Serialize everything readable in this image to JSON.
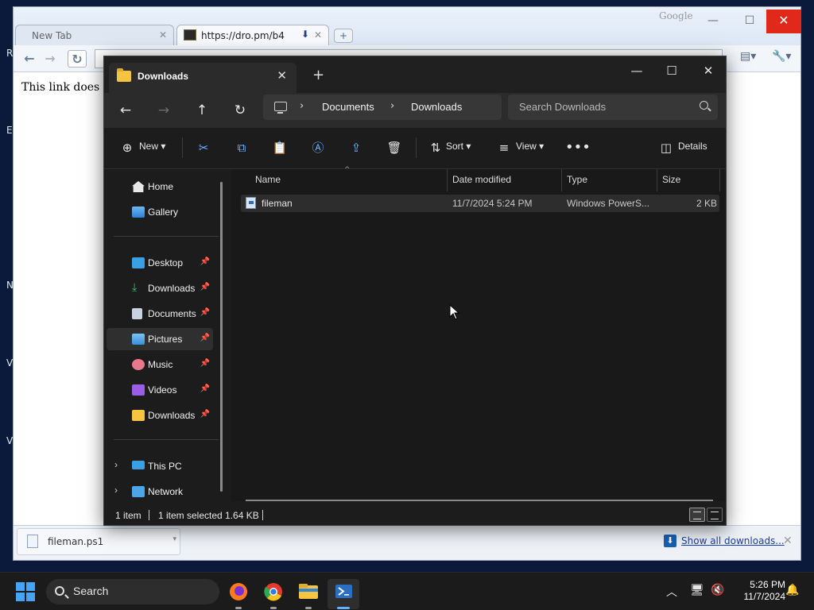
{
  "desktop": {
    "edge_letters": [
      "R",
      "E",
      "N",
      "V",
      "Vi"
    ]
  },
  "browser": {
    "tabs": [
      {
        "label": "New Tab"
      },
      {
        "label": "https://dro.pm/b4"
      }
    ],
    "brand": "Google",
    "page_text": "This link does not",
    "download_item": "fileman.ps1",
    "show_all_label": "Show all downloads..."
  },
  "explorer": {
    "tab_title": "Downloads",
    "breadcrumb": [
      "Documents",
      "Downloads"
    ],
    "search_placeholder": "Search Downloads",
    "commands": {
      "new": "New",
      "sort": "Sort",
      "view": "View",
      "details": "Details"
    },
    "sidebar": {
      "top": [
        {
          "label": "Home",
          "icon": "home-icon"
        },
        {
          "label": "Gallery",
          "icon": "gallery-icon"
        }
      ],
      "quick_access": [
        {
          "label": "Desktop",
          "icon": "desktop-folder-icon"
        },
        {
          "label": "Downloads",
          "icon": "downloads-folder-icon"
        },
        {
          "label": "Documents",
          "icon": "documents-folder-icon"
        },
        {
          "label": "Pictures",
          "icon": "pictures-folder-icon",
          "selected": true
        },
        {
          "label": "Music",
          "icon": "music-folder-icon"
        },
        {
          "label": "Videos",
          "icon": "videos-folder-icon"
        },
        {
          "label": "Downloads",
          "icon": "folder-icon"
        }
      ],
      "bottom": [
        {
          "label": "This PC",
          "icon": "this-pc-icon"
        },
        {
          "label": "Network",
          "icon": "network-icon"
        }
      ]
    },
    "columns": [
      "Name",
      "Date modified",
      "Type",
      "Size"
    ],
    "files": [
      {
        "name": "fileman",
        "date": "11/7/2024 5:24 PM",
        "type": "Windows PowerS...",
        "size": "2 KB"
      }
    ],
    "status": {
      "count": "1 item",
      "selection": "1 item selected  1.64 KB"
    }
  },
  "taskbar": {
    "search_label": "Search",
    "time": "5:26 PM",
    "date": "11/7/2024"
  }
}
